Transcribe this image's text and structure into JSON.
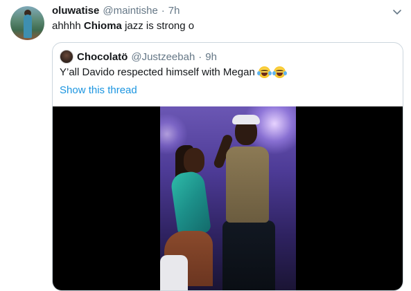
{
  "tweet": {
    "display_name": "oluwatise",
    "handle": "@maintishe",
    "separator": "·",
    "time": "7h",
    "text_before": "ahhhh ",
    "text_bold": "Chioma",
    "text_after": " jazz is strong o",
    "avatar_icon": "profile-photo"
  },
  "quoted": {
    "display_name": "Chocolatö",
    "handle": "@Justzeebah",
    "separator": "·",
    "time": "9h",
    "text": "Y’all Davido respected himself with Megan",
    "emojis": [
      "face-with-tears-of-joy",
      "face-with-tears-of-joy"
    ],
    "show_thread": "Show this thread"
  },
  "colors": {
    "link": "#1b95e0",
    "muted": "#657786",
    "border": "#ccd6dd"
  },
  "icons": {
    "menu": "chevron-down-icon"
  }
}
